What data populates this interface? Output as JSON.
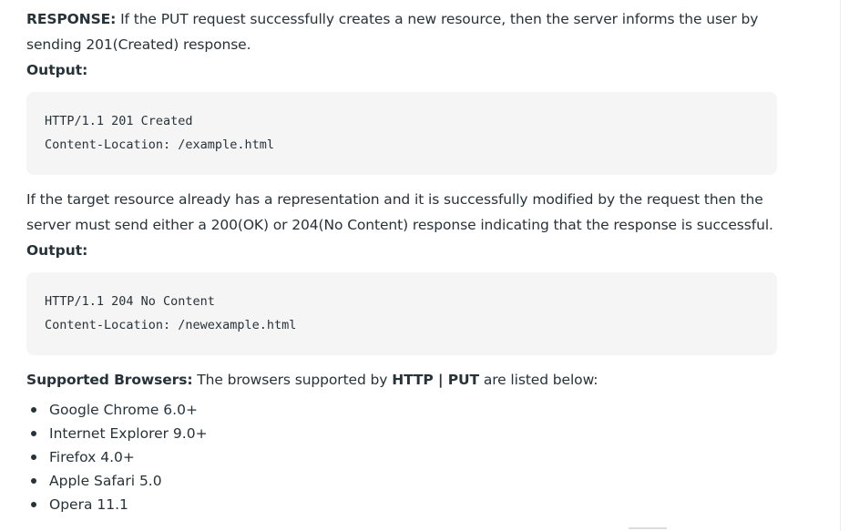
{
  "response_para": {
    "label": "RESPONSE:",
    "text": " If the PUT request successfully creates a new resource, then the server informs the user by sending 201(Created) response."
  },
  "output_label_1": "Output:",
  "code_block_1": {
    "lines": [
      "HTTP/1.1 201 Created",
      "Content-Location: /example.html"
    ]
  },
  "modified_para": "If the target resource already has a representation and it is successfully modified by the request then the server must send either a 200(OK) or 204(No Content) response indicating that the response is successful.",
  "output_label_2": "Output:",
  "code_block_2": {
    "lines": [
      "HTTP/1.1 204 No Content",
      "Content-Location: /newexample.html"
    ]
  },
  "supported": {
    "label": "Supported Browsers:",
    "text_before": " The browsers supported by ",
    "method": "HTTP | PUT",
    "text_after": " are listed below:"
  },
  "browsers": [
    "Google Chrome 6.0+",
    "Internet Explorer 9.0+",
    "Firefox 4.0+",
    "Apple Safari 5.0",
    "Opera 11.1"
  ]
}
